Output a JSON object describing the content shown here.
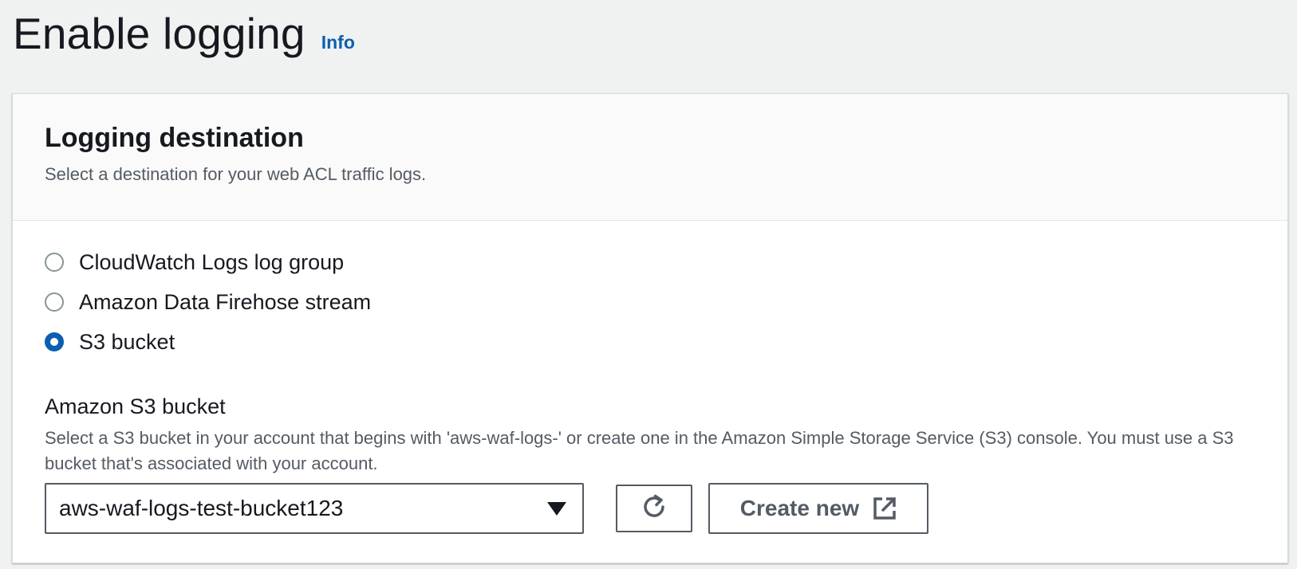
{
  "page": {
    "title": "Enable logging",
    "info_link": "Info"
  },
  "panel": {
    "title": "Logging destination",
    "description": "Select a destination for your web ACL traffic logs."
  },
  "destinations": [
    {
      "label": "CloudWatch Logs log group",
      "checked": false
    },
    {
      "label": "Amazon Data Firehose stream",
      "checked": false
    },
    {
      "label": "S3 bucket",
      "checked": true
    }
  ],
  "bucket": {
    "label": "Amazon S3 bucket",
    "description": "Select a S3 bucket in your account that begins with 'aws-waf-logs-' or create one in the Amazon Simple Storage Service (S3) console. You must use a S3 bucket that's associated with your account.",
    "selected_value": "aws-waf-logs-test-bucket123",
    "create_label": "Create new"
  },
  "icons": {
    "refresh": "refresh-icon",
    "external": "external-link-icon",
    "dropdown": "caret-down-icon"
  },
  "colors": {
    "accent": "#0c5fb0",
    "background": "#f0f1f1",
    "panel_header": "#fafafa",
    "text_primary": "#16191f",
    "text_secondary": "#545b64"
  }
}
